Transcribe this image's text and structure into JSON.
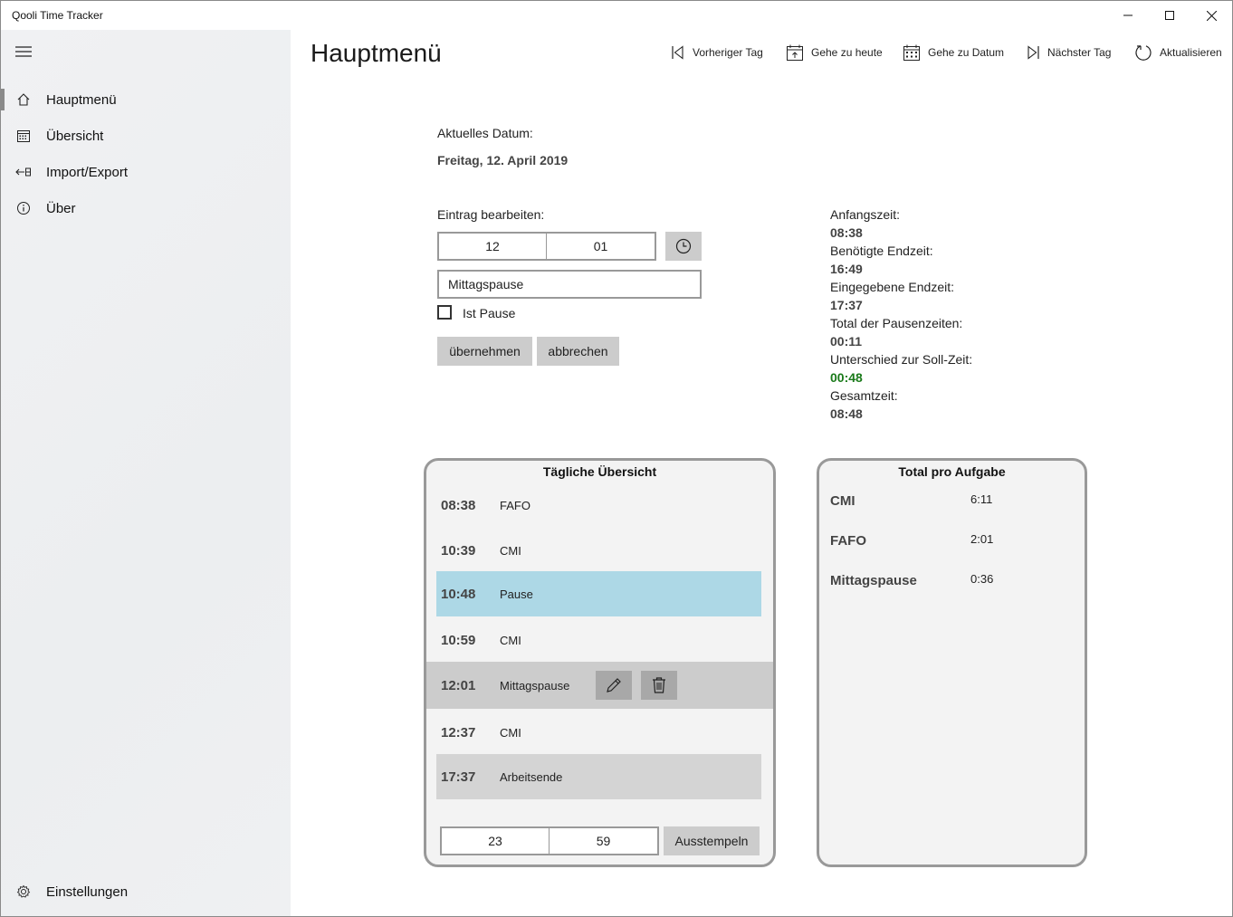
{
  "app": {
    "title": "Qooli Time Tracker"
  },
  "sidebar": {
    "items": [
      {
        "label": "Hauptmenü",
        "icon": "home-icon"
      },
      {
        "label": "Übersicht",
        "icon": "calendar-icon"
      },
      {
        "label": "Import/Export",
        "icon": "import-export-icon"
      },
      {
        "label": "Über",
        "icon": "info-icon"
      }
    ],
    "settings_label": "Einstellungen"
  },
  "header": {
    "title": "Hauptmenü",
    "commands": {
      "prev_day": "Vorheriger Tag",
      "today": "Gehe zu heute",
      "go_date": "Gehe zu Datum",
      "next_day": "Nächster Tag",
      "refresh": "Aktualisieren"
    }
  },
  "date": {
    "label": "Aktuelles Datum:",
    "value": "Freitag, 12. April 2019"
  },
  "edit": {
    "label": "Eintrag bearbeiten:",
    "hour": "12",
    "minute": "01",
    "description": "Mittagspause",
    "is_pause_label": "Ist Pause",
    "is_pause_checked": false,
    "apply_label": "übernehmen",
    "cancel_label": "abbrechen"
  },
  "stats": {
    "start_label": "Anfangszeit:",
    "start_value": "08:38",
    "required_end_label": "Benötigte Endzeit:",
    "required_end_value": "16:49",
    "entered_end_label": "Eingegebene Endzeit:",
    "entered_end_value": "17:37",
    "pause_total_label": "Total der Pausenzeiten:",
    "pause_total_value": "00:11",
    "diff_label": "Unterschied zur Soll-Zeit:",
    "diff_value": "00:48",
    "diff_color": "#1a7a1a",
    "total_label": "Gesamtzeit:",
    "total_value": "08:48"
  },
  "daily": {
    "title": "Tägliche Übersicht",
    "rows": [
      {
        "time": "08:38",
        "desc": "FAFO"
      },
      {
        "time": "10:39",
        "desc": "CMI"
      },
      {
        "time": "10:48",
        "desc": "Pause"
      },
      {
        "time": "10:59",
        "desc": "CMI"
      },
      {
        "time": "12:01",
        "desc": "Mittagspause"
      },
      {
        "time": "12:37",
        "desc": "CMI"
      },
      {
        "time": "17:37",
        "desc": "Arbeitsende"
      }
    ],
    "clockout_hour": "23",
    "clockout_minute": "59",
    "clockout_label": "Ausstempeln",
    "colors": {
      "pause": "#add8e6",
      "selected": "#cccccc",
      "end": "#d4d4d4"
    }
  },
  "totals": {
    "title": "Total pro Aufgabe",
    "rows": [
      {
        "name": "CMI",
        "value": "6:11"
      },
      {
        "name": "FAFO",
        "value": "2:01"
      },
      {
        "name": "Mittagspause",
        "value": "0:36"
      }
    ]
  }
}
